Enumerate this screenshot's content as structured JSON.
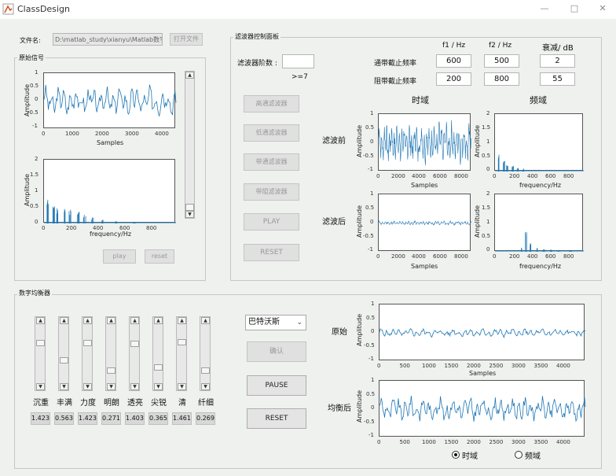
{
  "window": {
    "title": "ClassDesign",
    "minimize": "—",
    "maximize": "□",
    "close": "✕"
  },
  "file": {
    "label": "文件名:",
    "path": "D:\\matlab_study\\xianyu\\Matlab数字\\",
    "open_button": "打开文件"
  },
  "original_signal": {
    "title": "原始信号",
    "time_plot": {
      "ylabel": "Amplitude",
      "xlabel": "Samples",
      "yticks": [
        "1",
        "0.5",
        "0",
        "-0.5",
        "-1"
      ],
      "xticks": [
        "0",
        "1000",
        "2000",
        "3000",
        "4000"
      ]
    },
    "freq_plot": {
      "ylabel": "Amplitude",
      "xlabel": "frequency/Hz",
      "yticks": [
        "2",
        "1.5",
        "1",
        "0.5",
        "0"
      ],
      "xticks": [
        "0",
        "200",
        "400",
        "600",
        "800"
      ]
    },
    "play_button": "play",
    "reset_button": "reset"
  },
  "filter_panel": {
    "title": "滤波器控制面板",
    "order_label": "滤波器阶数 :",
    "order_value": "",
    "order_hint": ">=7",
    "col_f1": "f1 / Hz",
    "col_f2": "f2 / Hz",
    "col_atten": "衰减/ dB",
    "passband_label": "通带截止频率",
    "stopband_label": "阻带截止频率",
    "pass_f1": "600",
    "pass_f2": "500",
    "pass_atten": "2",
    "stop_f1": "200",
    "stop_f2": "800",
    "stop_atten": "55",
    "buttons": [
      "高通滤波器",
      "低通滤波器",
      "带通滤波器",
      "带阻滤波器",
      "PLAY",
      "RESET"
    ],
    "time_header": "时域",
    "freq_header": "频域",
    "before_label": "滤波前",
    "after_label": "滤波后",
    "time_plot": {
      "ylabel": "Amplitude",
      "xlabel": "Samples",
      "yticks": [
        "1",
        "0.5",
        "0",
        "-0.5",
        "-1"
      ],
      "xticks": [
        "0",
        "2000",
        "4000",
        "6000",
        "8000"
      ]
    },
    "freq_plot": {
      "ylabel": "Amplitude",
      "xlabel": "frequency/Hz",
      "yticks": [
        "2",
        "1.5",
        "1",
        "0.5",
        "0"
      ],
      "xticks": [
        "0",
        "200",
        "400",
        "600",
        "800"
      ]
    }
  },
  "equalizer": {
    "title": "数字均衡器",
    "bands": [
      {
        "label": "沉重",
        "value": "1.4231",
        "level": 0.3
      },
      {
        "label": "丰满",
        "value": "0.5631",
        "level": 0.62
      },
      {
        "label": "力度",
        "value": "1.4231",
        "level": 0.3
      },
      {
        "label": "明朗",
        "value": "0.2718",
        "level": 0.82
      },
      {
        "label": "透亮",
        "value": "1.4038",
        "level": 0.32
      },
      {
        "label": "尖锐",
        "value": "0.3653",
        "level": 0.76
      },
      {
        "label": "清",
        "value": "1.4615",
        "level": 0.28
      },
      {
        "label": "纤细",
        "value": "0.2692",
        "level": 0.82
      }
    ],
    "filter_type": "巴特沃斯",
    "confirm_button": "确认",
    "pause_button": "PAUSE",
    "reset_button": "RESET",
    "original_label": "原始",
    "equalized_label": "均衡后",
    "plot": {
      "ylabel": "Amplitude",
      "xlabel": "Samples",
      "yticks": [
        "1",
        "0.5",
        "0",
        "-0.5",
        "-1"
      ],
      "xticks": [
        "0",
        "500",
        "1000",
        "1500",
        "2000",
        "2500",
        "3000",
        "3500",
        "4000"
      ]
    },
    "radio_time": "时域",
    "radio_freq": "频域",
    "selected": "time"
  },
  "colors": {
    "line": "#1f77b4",
    "background": "#eef1ee",
    "panel_border": "#c6c6c6"
  }
}
